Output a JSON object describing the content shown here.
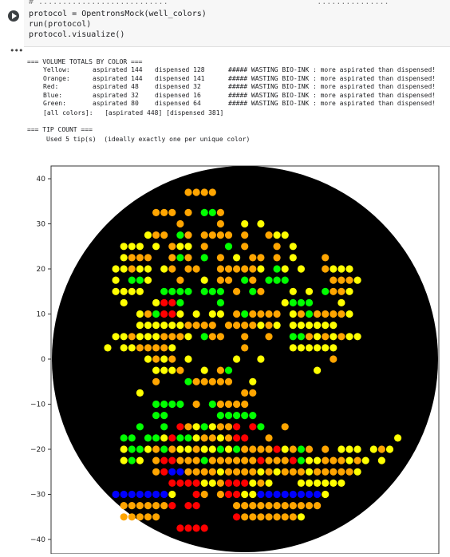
{
  "code": {
    "partial_line": "# ...........................                               ...............",
    "lines": [
      "protocol = OpentronsMock(well_colors)",
      "run(protocol)",
      "protocol.visualize()"
    ]
  },
  "output": {
    "volume_header": "=== VOLUME TOTALS BY COLOR ===",
    "rows": [
      {
        "name": "Yellow:",
        "aspirated": "aspirated 144",
        "dispensed": "dispensed 128",
        "warning": "##### WASTING BIO-INK : more aspirated than dispensed!"
      },
      {
        "name": "Orange:",
        "aspirated": "aspirated 144",
        "dispensed": "dispensed 141",
        "warning": "##### WASTING BIO-INK : more aspirated than dispensed!"
      },
      {
        "name": "Red:",
        "aspirated": "aspirated 48",
        "dispensed": "dispensed 32",
        "warning": "##### WASTING BIO-INK : more aspirated than dispensed!"
      },
      {
        "name": "Blue:",
        "aspirated": "aspirated 32",
        "dispensed": "dispensed 16",
        "warning": "##### WASTING BIO-INK : more aspirated than dispensed!"
      },
      {
        "name": "Green:",
        "aspirated": "aspirated 80",
        "dispensed": "dispensed 64",
        "warning": "##### WASTING BIO-INK : more aspirated than dispensed!"
      }
    ],
    "all_colors": "[all colors]:   [aspirated 448] [dispensed 381]",
    "tip_header": "=== TIP COUNT ===",
    "tip_line": "Used 5 tip(s)  (ideally exactly one per unique color)"
  },
  "chart_data": {
    "type": "scatter",
    "ylim": [
      -40,
      40
    ],
    "yticks": [
      "40",
      "30",
      "20",
      "10",
      "0",
      "−10",
      "−20",
      "−30",
      "−40"
    ],
    "background": "#000000",
    "colors": {
      "Y": "#ffff00",
      "O": "#ffa500",
      "R": "#ff0000",
      "B": "#0000ff",
      "G": "#00ff00"
    },
    "rows": [
      {
        "y": 37,
        "cells": "..........OOOO......................."
      },
      {
        "y": 32.5,
        "cells": "......OOO.O.GGO......................"
      },
      {
        "y": 30,
        "cells": ".........O....O..Y.Y................"
      },
      {
        "y": 27.5,
        "cells": ".....YOO.GO.OOOO.O..OYY.............."
      },
      {
        "y": 25,
        "cells": "..YYY.Y.OYY.O..G.O...O.Y............."
      },
      {
        "y": 22.5,
        "cells": "..YOOO..OGO.G.O.Y.OO.O.Y...O........."
      },
      {
        "y": 20,
        "cells": ".YYOYY.YO.OO..OOOOOY.GY.Y..OYYY......"
      },
      {
        "y": 17.5,
        "cells": ".Y.GGY...O..Y.OO.GO.GGG.....OOOY....."
      },
      {
        "y": 15,
        "cells": ".YYYY..GGGG.GGG.O.GO...Y.Y.GOOY......"
      },
      {
        "y": 12.5,
        "cells": "..Y...YRRG....G.......YGGG...Y......."
      },
      {
        "y": 10,
        "cells": "....YOGRRY.Y.YY.OGOOOO.YOGOOOOY......"
      },
      {
        "y": 7.5,
        "cells": "....YYYYYYOOOO.OOOOYOY.YYYYYY........"
      },
      {
        "y": 5,
        "cells": ".YYOYYYOOOY.GOO..O..O..GGOYOYOYY....."
      },
      {
        "y": 2.5,
        "cells": "Y.YYOOOOY........O.....YYYYYY........"
      },
      {
        "y": 0,
        "cells": ".....YOYO.Y.....Y..Y........O........"
      },
      {
        "y": -2.5,
        "cells": "......YYYO..Y.OG..........Y.........."
      },
      {
        "y": -5,
        "cells": "......O...GOOOOO..Y.................."
      },
      {
        "y": -7.5,
        "cells": "....Y............OO.................."
      },
      {
        "y": -10,
        "cells": "......GGGG.O.GOOOO..................."
      },
      {
        "y": -12.5,
        "cells": "......GG......GGGGG.................."
      },
      {
        "y": -15,
        "cells": "....G..G.ROYGYOOR.RG..O.............."
      },
      {
        "y": -17.5,
        "cells": "..GG.GGYRGGYOOYORR..O...............Y"
      },
      {
        "y": -20,
        "cells": "..YGGYOGOYYOYYGYGOOOORYOGO.O.YYY.YOY."
      },
      {
        "y": -22.5,
        "cells": "..YGY.ORROOOGOOOOOOROOORGYYOOOYOY.Y.."
      },
      {
        "y": -25,
        "cells": "......ORBBOOOOYOOOOYOYOOOYOOOOOY......"
      },
      {
        "y": -27.5,
        "cells": "........RRRRYYORRRYOY...YYYYYY......."
      },
      {
        "y": -30,
        "cells": ".BBBBBBBY..RO.ORRYYBBBBBBBBY........."
      },
      {
        "y": -32.5,
        "cells": "..OOOOOOR.RR....OOOOOOOOOOO.........."
      },
      {
        "y": -35,
        "cells": "..OOOOO.........ROOOOOOOY............"
      },
      {
        "y": -37.5,
        "cells": ".........RRRR........................"
      }
    ]
  }
}
